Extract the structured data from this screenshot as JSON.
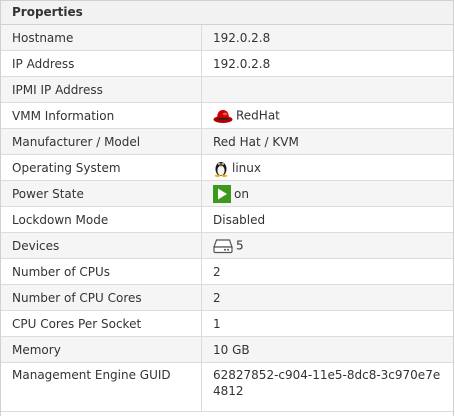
{
  "panel": {
    "title": "Properties"
  },
  "rows": [
    {
      "label": "Hostname",
      "value": "192.0.2.8"
    },
    {
      "label": "IP Address",
      "value": "192.0.2.8"
    },
    {
      "label": "IPMI IP Address",
      "value": ""
    },
    {
      "label": "VMM Information",
      "value": "RedHat",
      "icon": "redhat-icon"
    },
    {
      "label": "Manufacturer / Model",
      "value": "Red Hat / KVM"
    },
    {
      "label": "Operating System",
      "value": "linux",
      "icon": "linux-tux-icon"
    },
    {
      "label": "Power State",
      "value": "on",
      "icon": "power-on-icon"
    },
    {
      "label": "Lockdown Mode",
      "value": "Disabled"
    },
    {
      "label": "Devices",
      "value": "5",
      "icon": "storage-device-icon"
    },
    {
      "label": "Number of CPUs",
      "value": "2"
    },
    {
      "label": "Number of CPU Cores",
      "value": "2"
    },
    {
      "label": "CPU Cores Per Socket",
      "value": "1"
    },
    {
      "label": "Memory",
      "value": "10 GB"
    },
    {
      "label": "Management Engine GUID",
      "value": "62827852-c904-11e5-8dc8-3c970e7e4812"
    }
  ],
  "colors": {
    "power_on": "#3a9a1e",
    "redhat": "#cc0000"
  }
}
